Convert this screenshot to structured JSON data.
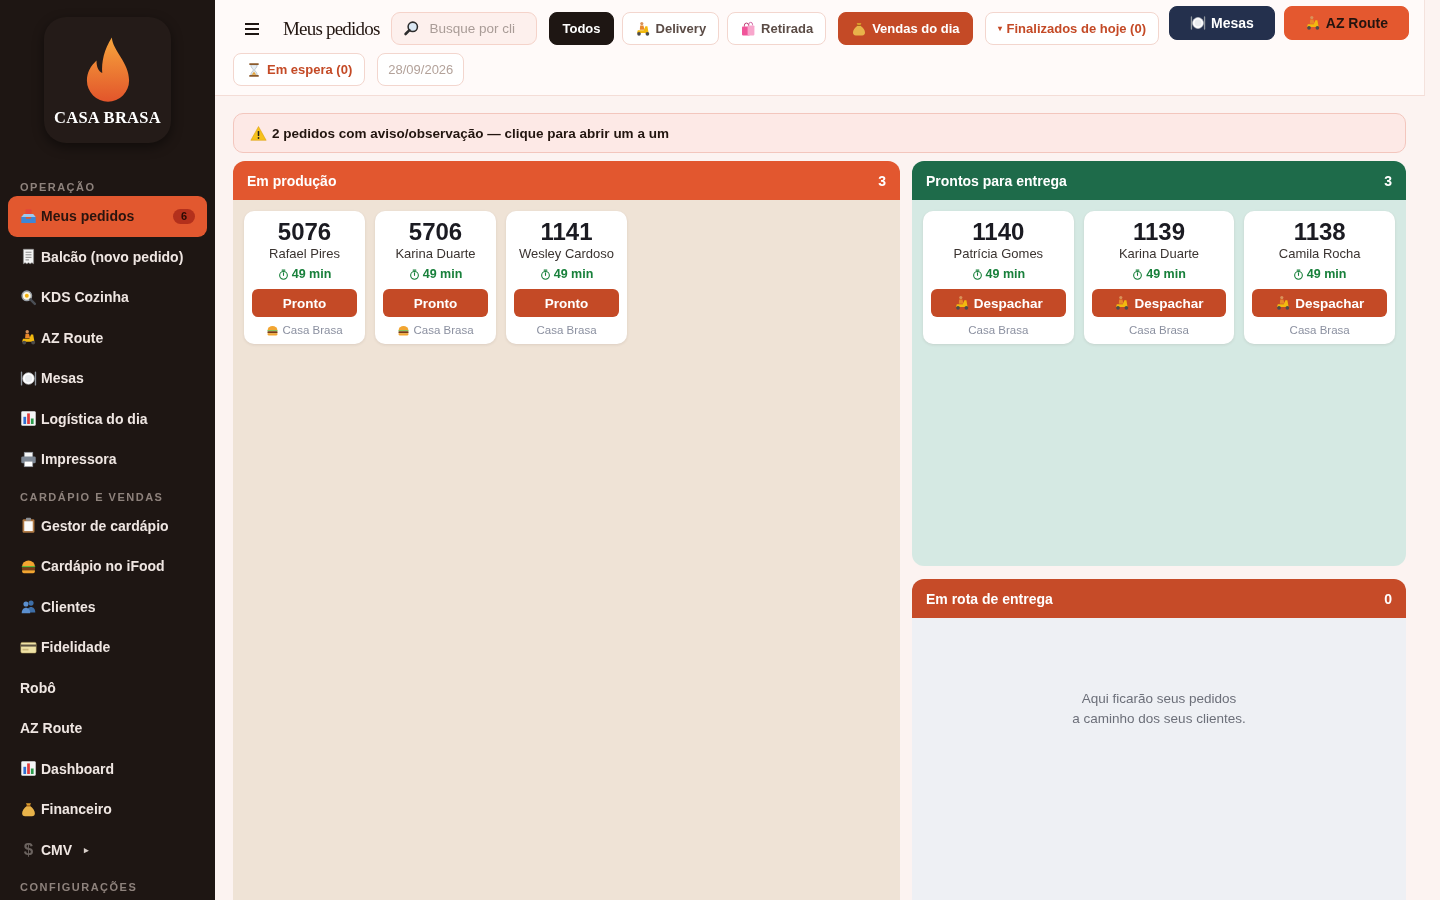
{
  "sidebar": {
    "brand": "CASA BRASA",
    "sections": [
      {
        "title": "OPERAÇÃO",
        "items": [
          {
            "label": "Meus pedidos",
            "selected": true,
            "badge": "6"
          },
          {
            "label": "Balcão (novo pedido)",
            "selected": false
          },
          {
            "label": "KDS Cozinha",
            "selected": false
          },
          {
            "label": "AZ Route",
            "selected": false
          },
          {
            "label": "Mesas",
            "selected": false
          },
          {
            "label": "Logística do dia",
            "selected": false
          },
          {
            "label": "Impressora",
            "selected": false
          }
        ]
      },
      {
        "title": "CARDÁPIO E VENDAS",
        "items": [
          {
            "label": "Gestor de cardápio",
            "selected": false
          },
          {
            "label": "Cardápio no iFood",
            "selected": false
          },
          {
            "label": "Clientes",
            "selected": false
          },
          {
            "label": "Fidelidade",
            "selected": false
          },
          {
            "label": "Robô",
            "selected": false
          },
          {
            "label": "AZ Route",
            "selected": false
          },
          {
            "label": "Dashboard",
            "selected": false
          },
          {
            "label": "Financeiro",
            "selected": false
          },
          {
            "glyph": "$",
            "label": "CMV",
            "selected": false,
            "caret": "▸"
          }
        ]
      },
      {
        "title": "CONFIGURAÇÕES"
      }
    ]
  },
  "header": {
    "title": "Meus pedidos",
    "search": {
      "placeholder": "Busque por cli"
    },
    "filters": [
      {
        "label": "Todos",
        "selected": true
      },
      {
        "label": "Delivery",
        "selected": false
      },
      {
        "label": "Retirada",
        "selected": false
      }
    ],
    "buttons": [
      {
        "label": "Vendas do dia"
      },
      {
        "caret": "▾",
        "label": "Finalizados de hoje (0)"
      },
      {
        "label": "Em espera (0)"
      }
    ],
    "date": {
      "value": "28/09/2026"
    },
    "actions": [
      {
        "label": "Mesas"
      },
      {
        "label": "AZ Route"
      }
    ]
  },
  "alert": {
    "text": "2 pedidos com aviso/observação — clique para abrir um a um"
  },
  "columns": [
    {
      "title": "Em produção",
      "count": "3",
      "orders": [
        {
          "number": "5076",
          "customer": "Rafael Pires",
          "elapsed": "49 min",
          "action": {
            "kind": "ready",
            "label": "Pronto"
          },
          "store": "Casa Brasa",
          "store_icon": true
        },
        {
          "number": "5706",
          "customer": "Karina Duarte",
          "elapsed": "49 min",
          "action": {
            "kind": "ready",
            "label": "Pronto"
          },
          "store": "Casa Brasa",
          "store_icon": true
        },
        {
          "number": "1141",
          "customer": "Wesley Cardoso",
          "elapsed": "49 min",
          "action": {
            "kind": "ready",
            "label": "Pronto"
          },
          "store": "Casa Brasa",
          "store_icon": false
        }
      ]
    },
    {
      "title": "Prontos para entrega",
      "count": "3",
      "orders": [
        {
          "number": "1140",
          "customer": "Patrícia Gomes",
          "elapsed": "49 min",
          "action": {
            "kind": "dispatch",
            "label": "Despachar"
          },
          "store": "Casa Brasa",
          "store_icon": false
        },
        {
          "number": "1139",
          "customer": "Karina Duarte",
          "elapsed": "49 min",
          "action": {
            "kind": "dispatch",
            "label": "Despachar"
          },
          "store": "Casa Brasa",
          "store_icon": false
        },
        {
          "number": "1138",
          "customer": "Camila Rocha",
          "elapsed": "49 min",
          "action": {
            "kind": "dispatch",
            "label": "Despachar"
          },
          "store": "Casa Brasa",
          "store_icon": false
        }
      ]
    },
    {
      "title": "Em rota de entrega",
      "count": "0",
      "empty_text": "Aqui ficarão seus pedidos\na caminho dos seus clientes."
    }
  ]
}
